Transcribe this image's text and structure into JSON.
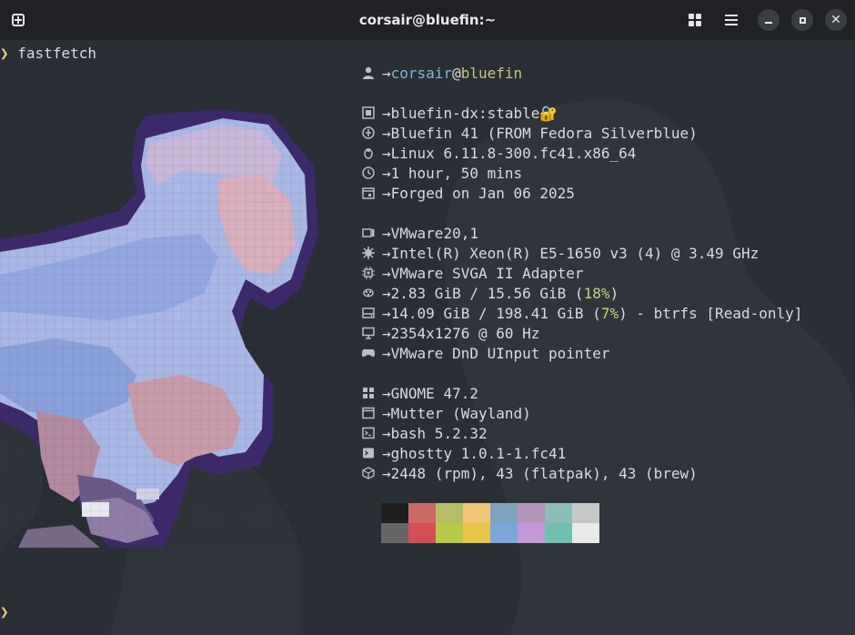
{
  "window": {
    "title": "corsair@bluefin:~"
  },
  "terminal": {
    "prompt_symbol": "❯",
    "command": "fastfetch",
    "bottom_prompt_symbol": "❯"
  },
  "info": {
    "user": "corsair",
    "at": "@",
    "host": "bluefin",
    "arrow": "→",
    "image": "bluefin-dx:stable",
    "image_lock": "🔐",
    "os": "Bluefin 41 (FROM Fedora Silverblue)",
    "kernel": "Linux 6.11.8-300.fc41.x86_64",
    "uptime": "1 hour, 50 mins",
    "forged": "Forged on Jan 06 2025",
    "host_model": "VMware20,1",
    "cpu": "Intel(R) Xeon(R) E5-1650 v3 (4) @ 3.49 GHz",
    "gpu": "VMware SVGA II Adapter",
    "memory_prefix": "2.83 GiB / 15.56 GiB (",
    "memory_pct": "18%",
    "memory_suffix": ")",
    "disk_prefix": "14.09 GiB / 198.41 GiB (",
    "disk_pct": "7%",
    "disk_suffix": ") - btrfs [Read-only]",
    "display": "2354x1276 @ 60 Hz",
    "input": "VMware DnD UInput pointer",
    "de": "GNOME 47.2",
    "wm": "Mutter (Wayland)",
    "shell": "bash 5.2.32",
    "terminal": "ghostty 1.0.1-1.fc41",
    "packages": "2448 (rpm), 43 (flatpak), 43 (brew)"
  },
  "palette": {
    "top": [
      "#1f1f1f",
      "#cc6a66",
      "#b5bd68",
      "#f0c674",
      "#81a2be",
      "#b294bb",
      "#8abeb7",
      "#c5c8c6"
    ],
    "bottom": [
      "#666666",
      "#d54e53",
      "#b9ca4a",
      "#e7c547",
      "#7aa6da",
      "#c397d8",
      "#70c0b1",
      "#eaeaea"
    ]
  }
}
